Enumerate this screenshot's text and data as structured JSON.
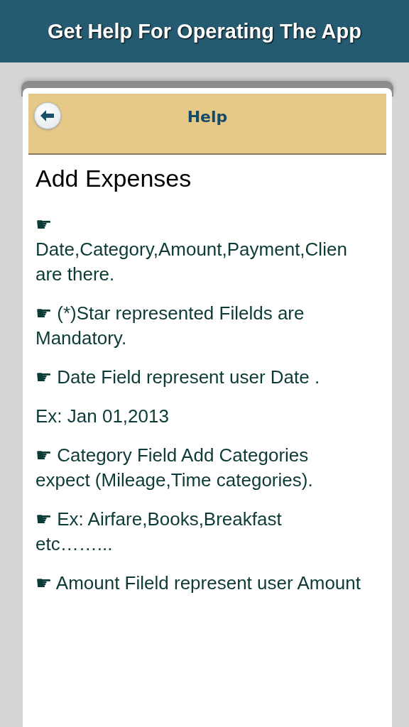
{
  "app_bar": {
    "title": "Get Help For Operating The App"
  },
  "panel": {
    "title": "Help"
  },
  "content": {
    "heading": "Add Expenses",
    "paragraphs": [
      "☛ Date,Category,Amount,Payment,Clien are there.",
      "☛ (*)Star represented Filelds are Mandatory.",
      "☛ Date Field represent user Date .",
      "Ex: Jan 01,2013",
      "☛ Category Field Add Categories expect (Mileage,Time categories).",
      "☛ Ex: Airfare,Books,Breakfast etc……...",
      "☛ Amount Fileld represent user Amount"
    ]
  }
}
